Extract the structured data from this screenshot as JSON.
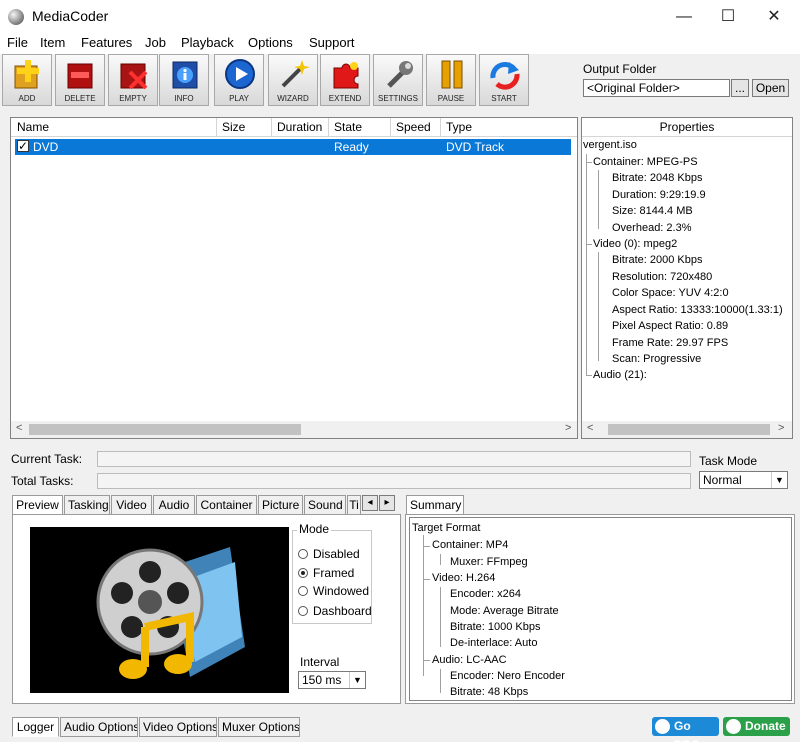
{
  "window": {
    "title": "MediaCoder",
    "minimize": "—",
    "maximize": "☐",
    "close": "✕"
  },
  "menu": [
    "File",
    "Item",
    "Features",
    "Job",
    "Playback",
    "Options",
    "Support"
  ],
  "toolbar": {
    "add": "ADD",
    "delete": "DELETE",
    "empty": "EMPTY",
    "info": "INFO",
    "play": "PLAY",
    "wizard": "WIZARD",
    "extend": "EXTEND",
    "settings": "SETTINGS",
    "pause": "PAUSE",
    "start": "START"
  },
  "output": {
    "label": "Output Folder",
    "value": "<Original Folder>",
    "browse": "...",
    "open": "Open"
  },
  "list": {
    "columns": [
      "Name",
      "Size",
      "Duration",
      "State",
      "Speed",
      "Type"
    ],
    "rows": [
      {
        "checked": "✓",
        "name": "DVD",
        "size": "",
        "duration": "",
        "state": "Ready",
        "speed": "",
        "type": "DVD Track"
      }
    ],
    "scroll_left": "<",
    "scroll_right": ">"
  },
  "properties": {
    "header": "Properties",
    "file": "vergent.iso",
    "container": "Container: MPEG-PS",
    "container_items": [
      "Bitrate: 2048 Kbps",
      "Duration: 9:29:19.9",
      "Size: 8144.4 MB",
      "Overhead: 2.3%"
    ],
    "video": "Video (0): mpeg2",
    "video_items": [
      "Bitrate: 2000 Kbps",
      "Resolution: 720x480",
      "Color Space: YUV 4:2:0",
      "Aspect Ratio: 13333:10000(1.33:1)",
      "Pixel Aspect Ratio: 0.89",
      "Frame Rate: 29.97 FPS",
      "Scan: Progressive"
    ],
    "audio": "Audio (21):",
    "scroll_left": "<",
    "scroll_right": ">"
  },
  "tasks": {
    "current_label": "Current Task:",
    "total_label": "Total Tasks:",
    "mode_label": "Task Mode",
    "mode_value": "Normal"
  },
  "settings_tabs": [
    "Preview",
    "Tasking",
    "Video",
    "Audio",
    "Container",
    "Picture",
    "Sound",
    "Ti"
  ],
  "tab_scroll": {
    "left": "◂",
    "right": "▸"
  },
  "preview": {
    "mode_title": "Mode",
    "modes": [
      "Disabled",
      "Framed",
      "Windowed",
      "Dashboard"
    ],
    "selected_mode": "Framed",
    "interval_label": "Interval",
    "interval_value": "150 ms"
  },
  "summary": {
    "tab": "Summary",
    "title": "Target Format",
    "container": "Container: MP4",
    "muxer": "Muxer: FFmpeg",
    "video": "Video: H.264",
    "video_items": [
      "Encoder: x264",
      "Mode: Average Bitrate",
      "Bitrate: 1000 Kbps",
      "De-interlace: Auto"
    ],
    "audio": "Audio: LC-AAC",
    "audio_items": [
      "Encoder: Nero Encoder",
      "Bitrate: 48 Kbps"
    ]
  },
  "bottom_tabs": [
    "Logger",
    "Audio Options",
    "Video Options",
    "Muxer Options"
  ],
  "buttons": {
    "go_pro": "Go PRO",
    "donate": "Donate"
  },
  "colors": {
    "selection": "#0a78d7",
    "go_pro": "#1c8ad6",
    "donate": "#2aa148"
  }
}
